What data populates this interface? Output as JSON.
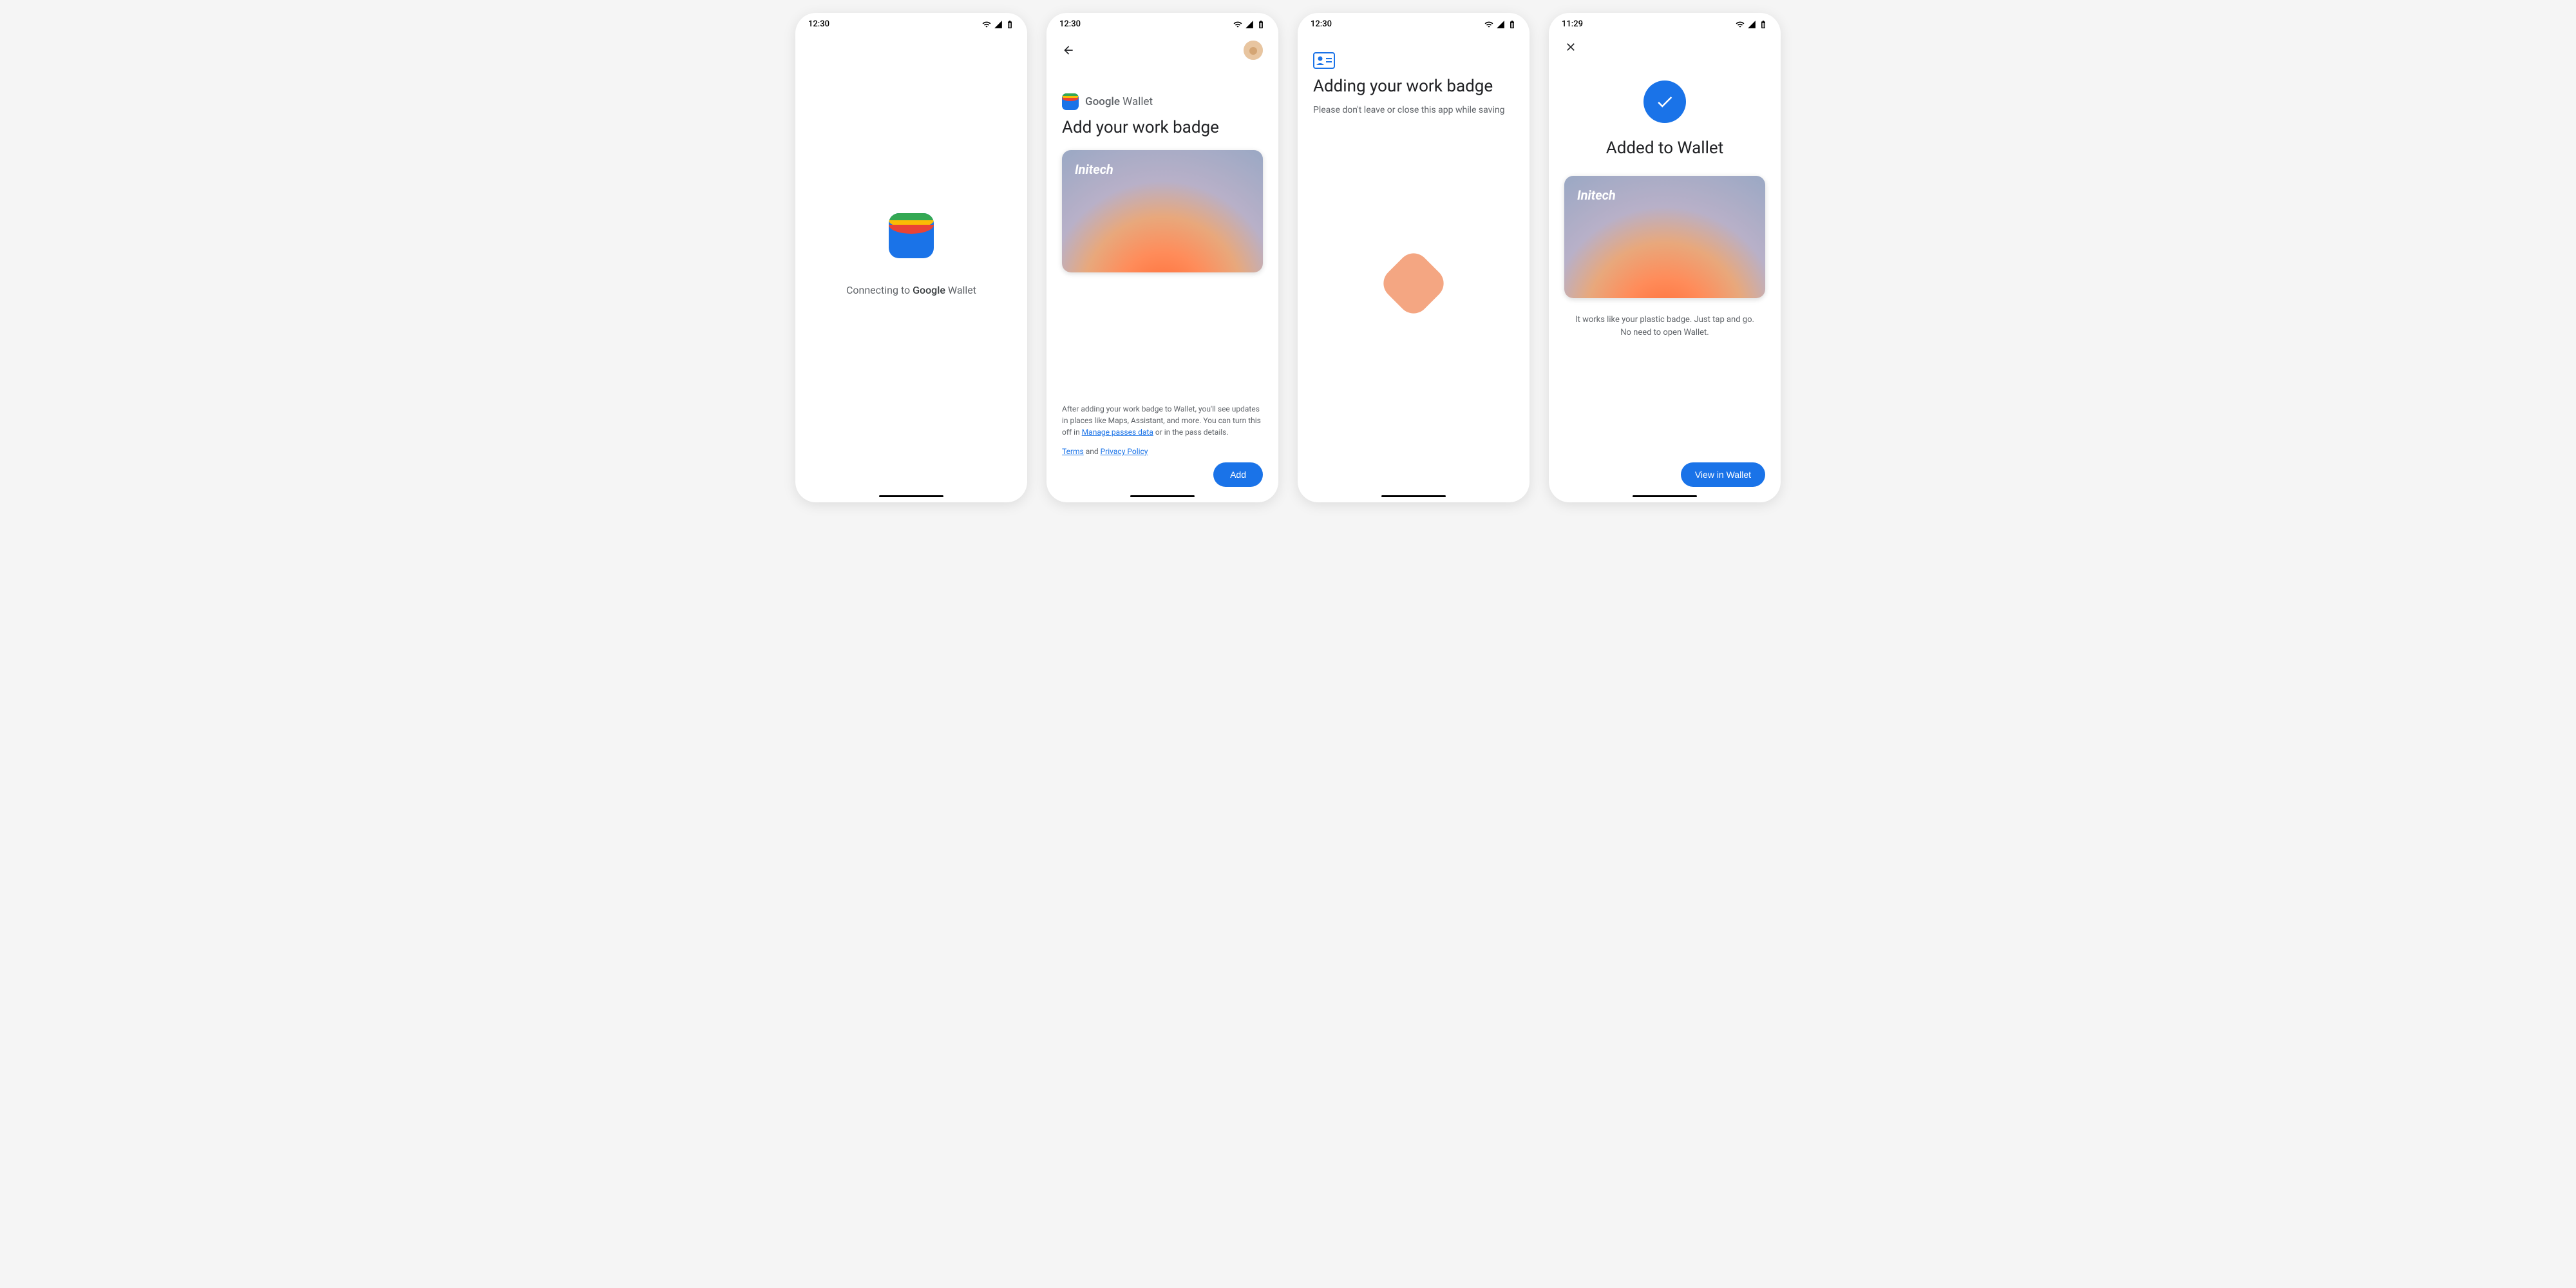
{
  "status": {
    "time1": "12:30",
    "time2": "12:30",
    "time3": "12:30",
    "time4": "11:29"
  },
  "screen1": {
    "connecting_prefix": "Connecting to ",
    "google": "Google",
    "wallet": " Wallet"
  },
  "screen2": {
    "brand_google": "Google",
    "brand_wallet": " Wallet",
    "title": "Add your work badge",
    "card_brand": "Initech",
    "footer_text_1": "After adding your work badge to Wallet, you'll see updates in places like Maps, Assistant, and more. You can turn this off in ",
    "footer_link": "Manage passes data",
    "footer_text_2": " or in the pass details.",
    "terms": "Terms",
    "and": " and ",
    "privacy": "Privacy Policy",
    "add_button": "Add"
  },
  "screen3": {
    "title": "Adding your work badge",
    "subtitle": "Please don't leave or close this app while saving"
  },
  "screen4": {
    "title": "Added to Wallet",
    "card_brand": "Initech",
    "description": "It works like your plastic badge. Just tap and go. No need to open Wallet.",
    "view_button": "View in Wallet"
  }
}
